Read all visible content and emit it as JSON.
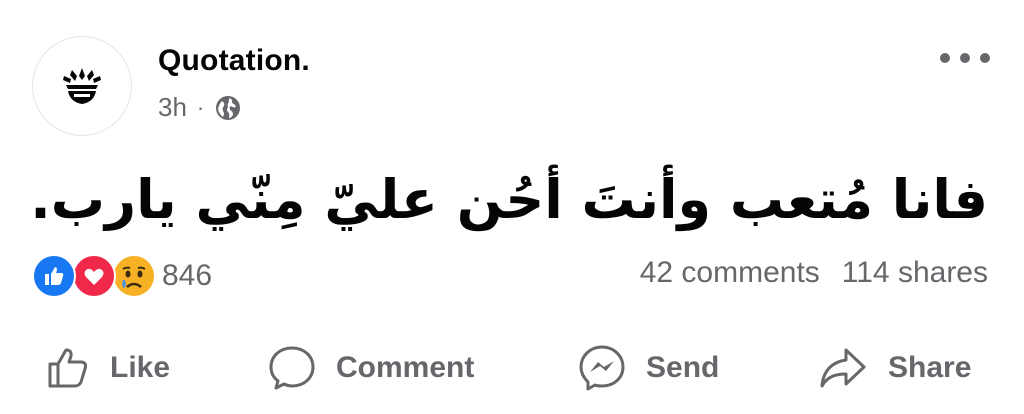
{
  "post": {
    "author": "Quotation.",
    "time": "3h",
    "separator": "·",
    "audience_icon": "globe-icon",
    "menu_icon": "more-options-icon",
    "text": "فانا مُتعب وأنتَ أحُن عليّ مِنّي يارب."
  },
  "reactions": {
    "types": [
      "like",
      "love",
      "sad"
    ],
    "count": "846"
  },
  "stats": {
    "comments": "42 comments",
    "shares": "114 shares"
  },
  "actions": {
    "like": "Like",
    "comment": "Comment",
    "send": "Send",
    "share": "Share"
  },
  "colors": {
    "like_blue": "#1877f2",
    "love_red": "#f02849",
    "sad_yellow": "#f7b125",
    "secondary_text": "#65676b"
  }
}
